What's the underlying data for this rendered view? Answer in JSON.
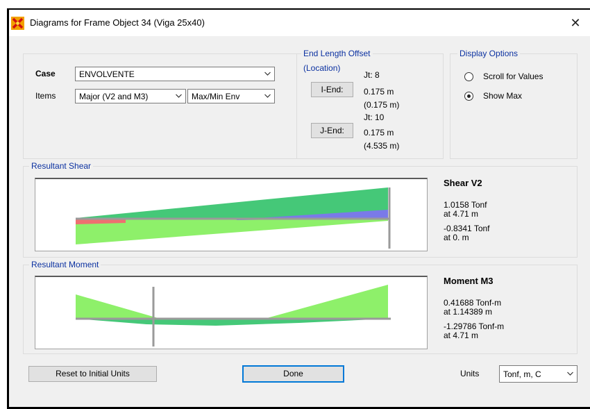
{
  "window": {
    "title": "Diagrams for Frame Object 34  (Viga 25x40)",
    "close_glyph": "✕"
  },
  "case": {
    "label": "Case",
    "value": "ENVOLVENTE"
  },
  "items": {
    "label": "Items",
    "component": "Major (V2 and M3)",
    "envelope": "Max/Min Env"
  },
  "end_length_offset": {
    "title": "End Length Offset",
    "location_label": "(Location)",
    "i_end": {
      "button": "I-End:",
      "joint": "Jt:  8",
      "offset": "0.175 m",
      "location": "(0.175 m)"
    },
    "j_end": {
      "button": "J-End:",
      "joint": "Jt:  10",
      "offset": "0.175 m",
      "location": "(4.535 m)"
    }
  },
  "display_options": {
    "title": "Display Options",
    "options": [
      {
        "label": "Scroll for Values",
        "selected": false
      },
      {
        "label": "Show Max",
        "selected": true
      }
    ]
  },
  "shear": {
    "title": "Resultant Shear",
    "heading": "Shear V2",
    "max_value": "1.0158 Tonf",
    "max_at": "at 4.71 m",
    "min_value": "-0.8341 Tonf",
    "min_at": "at 0. m"
  },
  "moment": {
    "title": "Resultant Moment",
    "heading": "Moment M3",
    "max_value": "0.41688 Tonf-m",
    "max_at": "at 1.14389 m",
    "min_value": "-1.29786 Tonf-m",
    "min_at": "at 4.71 m"
  },
  "footer": {
    "reset_label": "Reset to Initial Units",
    "done_label": "Done",
    "units_label": "Units",
    "units_value": "Tonf, m, C"
  },
  "colors": {
    "diagram_green": "#45c878",
    "diagram_light_green": "#8ef06a",
    "diagram_blue": "#7a7ae8",
    "diagram_red": "#ee7070",
    "legend_blue": "#0a30a0",
    "focus_border": "#0078d7"
  },
  "icons": {
    "app": "sap2000-app-icon",
    "dropdown": "chevron-down-icon",
    "close": "close-icon"
  }
}
